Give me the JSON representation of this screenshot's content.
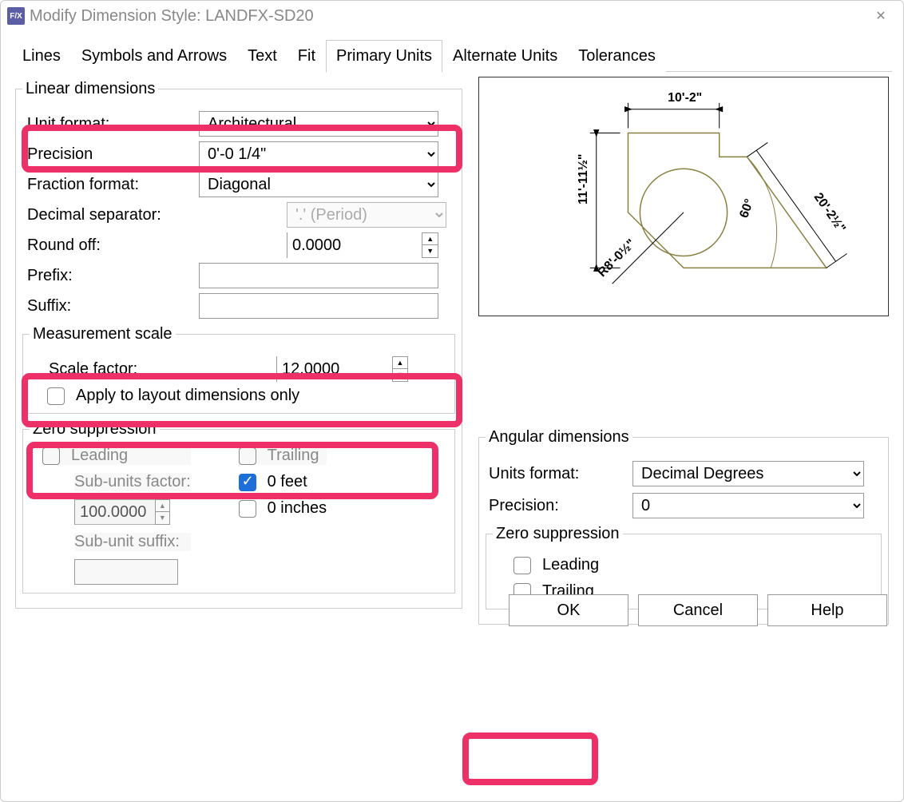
{
  "title": "Modify Dimension Style: LANDFX-SD20",
  "tabs": [
    "Lines",
    "Symbols and Arrows",
    "Text",
    "Fit",
    "Primary Units",
    "Alternate Units",
    "Tolerances"
  ],
  "active_tab": 4,
  "linear": {
    "legend": "Linear dimensions",
    "unit_format_label": "Unit format:",
    "unit_format": "Architectural",
    "precision_label": "Precision",
    "precision": "0'-0 1/4\"",
    "fraction_label": "Fraction format:",
    "fraction": "Diagonal",
    "decimal_sep_label": "Decimal separator:",
    "decimal_sep": "'.' (Period)",
    "roundoff_label": "Round off:",
    "roundoff": "0.0000",
    "prefix_label": "Prefix:",
    "prefix": "",
    "suffix_label": "Suffix:",
    "suffix": ""
  },
  "measurement": {
    "legend": "Measurement scale",
    "scale_label": "Scale factor:",
    "scale": "12.0000",
    "apply_layout_label": "Apply to layout dimensions only"
  },
  "zero": {
    "legend": "Zero suppression",
    "leading": "Leading",
    "trailing": "Trailing",
    "sub_factor_label": "Sub-units factor:",
    "sub_factor": "100.0000",
    "sub_suffix_label": "Sub-unit suffix:",
    "feet": "0 feet",
    "inches": "0 inches"
  },
  "angular": {
    "legend": "Angular dimensions",
    "units_label": "Units format:",
    "units": "Decimal Degrees",
    "precision_label": "Precision:",
    "precision": "0",
    "zero_legend": "Zero suppression",
    "leading": "Leading",
    "trailing": "Trailing"
  },
  "buttons": {
    "ok": "OK",
    "cancel": "Cancel",
    "help": "Help"
  },
  "preview": {
    "top": "10'-2\"",
    "left": "11'-11½\"",
    "angle": "60°",
    "diag": "20'-2½\"",
    "radius": "R8'-0½\""
  }
}
